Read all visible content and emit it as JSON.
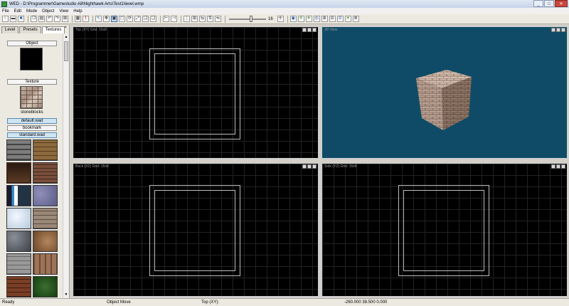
{
  "window": {
    "title": "WED - D:\\Programmer\\Gamestudio A8\\Nighthawk Arts\\Test1\\level.wmp"
  },
  "menu": [
    "File",
    "Edit",
    "Mode",
    "Object",
    "View",
    "Help"
  ],
  "toolbar": {
    "slider_value": "16",
    "slider_level": 0.6
  },
  "left_panel": {
    "tabs": [
      "Level",
      "Presets",
      "Textures"
    ],
    "active_tab": "Textures",
    "close_glyph": "×",
    "object_label": "Object",
    "texture_label": "Texture",
    "texture_name": "stoneblocks",
    "wad_buttons": [
      "default.wad",
      "bookmark",
      "standard.wad"
    ]
  },
  "viewports": {
    "top": {
      "label": "Top (XY) Grid: 16x8"
    },
    "view3d": {
      "label": "3D View"
    },
    "back": {
      "label": "Back (XZ) Grid: 16x8"
    },
    "side": {
      "label": "Side (YZ) Grid: 16x8"
    }
  },
  "status": {
    "ready": "Ready",
    "mode": "Object Move",
    "view": "Top (XY):",
    "coords": "-260.000 38.500 0.000"
  },
  "colors": {
    "view3d_bg": "#0f4b66",
    "viewport_bg": "#000000"
  }
}
